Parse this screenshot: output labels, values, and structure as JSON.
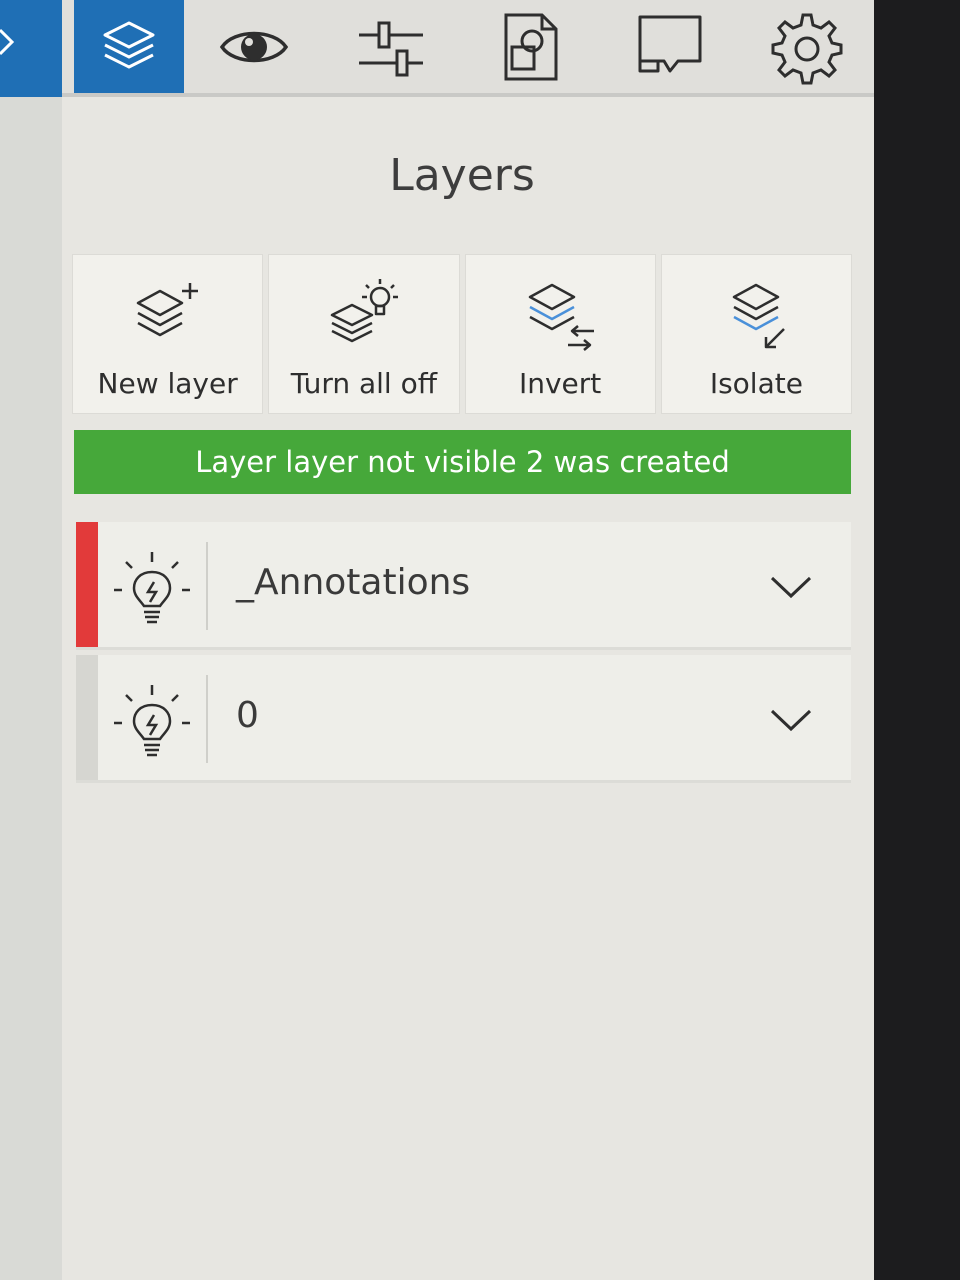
{
  "panel": {
    "title": "Layers"
  },
  "toolbar": {
    "items": [
      {
        "icon": "layers-icon",
        "active": true
      },
      {
        "icon": "eye-icon",
        "active": false
      },
      {
        "icon": "sliders-icon",
        "active": false
      },
      {
        "icon": "document-shapes-icon",
        "active": false
      },
      {
        "icon": "comment-icon",
        "active": false
      },
      {
        "icon": "gear-icon",
        "active": false
      }
    ]
  },
  "actions": [
    {
      "label": "New layer",
      "icon": "new-layer-icon"
    },
    {
      "label": "Turn all off",
      "icon": "turn-all-off-icon"
    },
    {
      "label": "Invert",
      "icon": "invert-icon"
    },
    {
      "label": "Isolate",
      "icon": "isolate-icon"
    }
  ],
  "banner": {
    "message": "Layer layer not visible 2 was created",
    "color": "#46a83a"
  },
  "layers": [
    {
      "name": "_Annotations",
      "accent_color": "#e23a3a",
      "icon": "lightbulb-icon"
    },
    {
      "name": "0",
      "accent_color": "",
      "icon": "lightbulb-icon"
    }
  ],
  "colors": {
    "accent": "#1f6fb5",
    "success": "#46a83a",
    "layer_marker": "#e23a3a"
  }
}
